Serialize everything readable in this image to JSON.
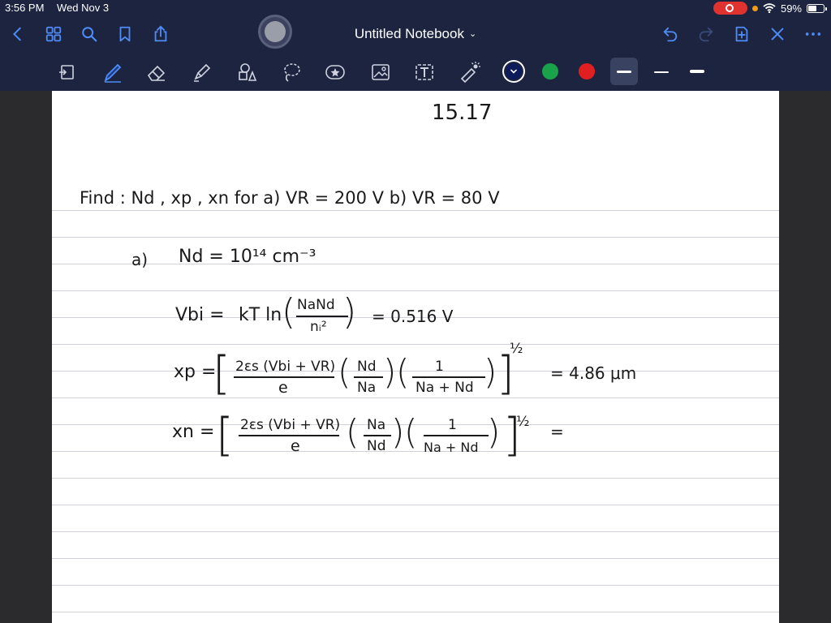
{
  "status_bar": {
    "time": "3:56 PM",
    "date": "Wed Nov 3",
    "battery": "59%",
    "battery_level": 0.59
  },
  "nav": {
    "title": "Untitled Notebook",
    "title_chevron": "⌄"
  },
  "icons": {
    "back": "chevron-left-icon",
    "grid": "grid-icon",
    "search": "search-icon",
    "bookmark": "bookmark-icon",
    "share": "share-icon",
    "undo": "undo-icon",
    "redo": "redo-icon",
    "add_page": "add-page-icon",
    "close": "close-icon",
    "more": "more-icon"
  },
  "toolbar": {
    "colors": [
      "#0d1b5c",
      "#1aa24a",
      "#e02020"
    ],
    "selected_color": 0
  },
  "notes": {
    "heading": "15.17",
    "line1": "Find :  Nd , xp , xn      for  a)  VR = 200 V     b)  VR = 80 V",
    "line2_label": "a)",
    "line2": "Nd = 10¹⁴ cm⁻³",
    "vbi_lhs": "Vbi =",
    "vbi_rhs": "kT ln",
    "vbi_num": "NaNd",
    "vbi_den": "nᵢ²",
    "vbi_result": "= 0.516 V",
    "xp_lhs": "xp =",
    "xp_num": "2εs (Vbi + VR)",
    "xp_den": "e",
    "xp_f2_num": "Nd",
    "xp_f2_den": "Na",
    "xp_f3_num": "1",
    "xp_f3_den": "Na + Nd",
    "xp_exp": "½",
    "xp_result": "= 4.86 μm",
    "xn_lhs": "xn =",
    "xn_num": "2εs (Vbi + VR)",
    "xn_den": "e",
    "xn_f2_num": "Na",
    "xn_f2_den": "Nd",
    "xn_f3_num": "1",
    "xn_f3_den": "Na + Nd",
    "xn_exp": "½",
    "xn_result": "="
  }
}
